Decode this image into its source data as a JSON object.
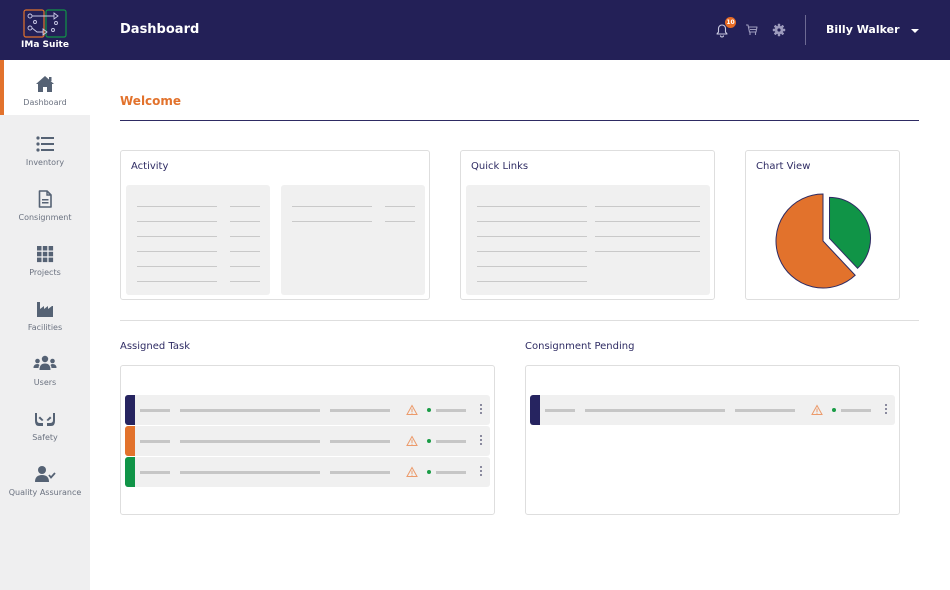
{
  "app": {
    "name": "IMa Suite",
    "page_title": "Dashboard"
  },
  "header": {
    "notifications": {
      "icon": "bell-icon",
      "count": "10"
    },
    "cart": {
      "icon": "cart-icon"
    },
    "settings": {
      "icon": "gear-icon"
    },
    "user": {
      "name": "Billy Walker",
      "menu_icon": "caret-down-icon"
    }
  },
  "sidebar": {
    "items": [
      {
        "label": "Dashboard",
        "icon": "home-icon",
        "active": true
      },
      {
        "label": "Inventory",
        "icon": "list-icon",
        "active": false
      },
      {
        "label": "Consignment",
        "icon": "document-icon",
        "active": false
      },
      {
        "label": "Projects",
        "icon": "grid-icon",
        "active": false
      },
      {
        "label": "Facilities",
        "icon": "factory-icon",
        "active": false
      },
      {
        "label": "Users",
        "icon": "users-icon",
        "active": false
      },
      {
        "label": "Safety",
        "icon": "hands-icon",
        "active": false
      },
      {
        "label": "Quality Assurance",
        "icon": "user-check-icon",
        "active": false
      }
    ]
  },
  "main": {
    "welcome": "Welcome",
    "cards": {
      "activity": {
        "title": "Activity"
      },
      "quick_links": {
        "title": "Quick Links"
      },
      "chart_view": {
        "title": "Chart View"
      }
    },
    "assigned_task": {
      "title": "Assigned Task",
      "rows": [
        {
          "accent": "#262460",
          "status_icon": "warning-icon",
          "status_dot": "#1a9c46"
        },
        {
          "accent": "#e2722c",
          "status_icon": "warning-icon",
          "status_dot": "#1a9c46"
        },
        {
          "accent": "#109447",
          "status_icon": "warning-icon",
          "status_dot": "#1a9c46"
        }
      ]
    },
    "consignment_pending": {
      "title": "Consignment Pending",
      "rows": [
        {
          "accent": "#262460",
          "status_icon": "warning-icon",
          "status_dot": "#1a9c46"
        }
      ]
    }
  },
  "colors": {
    "header_bg": "#232057",
    "accent_orange": "#e2722c",
    "accent_green": "#109447",
    "accent_navy": "#262460"
  },
  "chart_data": {
    "type": "pie",
    "title": "Chart View",
    "categories": [
      "Green segment",
      "Orange segment"
    ],
    "values": [
      38,
      62
    ],
    "colors": [
      "#109447",
      "#e2722c"
    ],
    "exploded": [
      true,
      false
    ]
  }
}
